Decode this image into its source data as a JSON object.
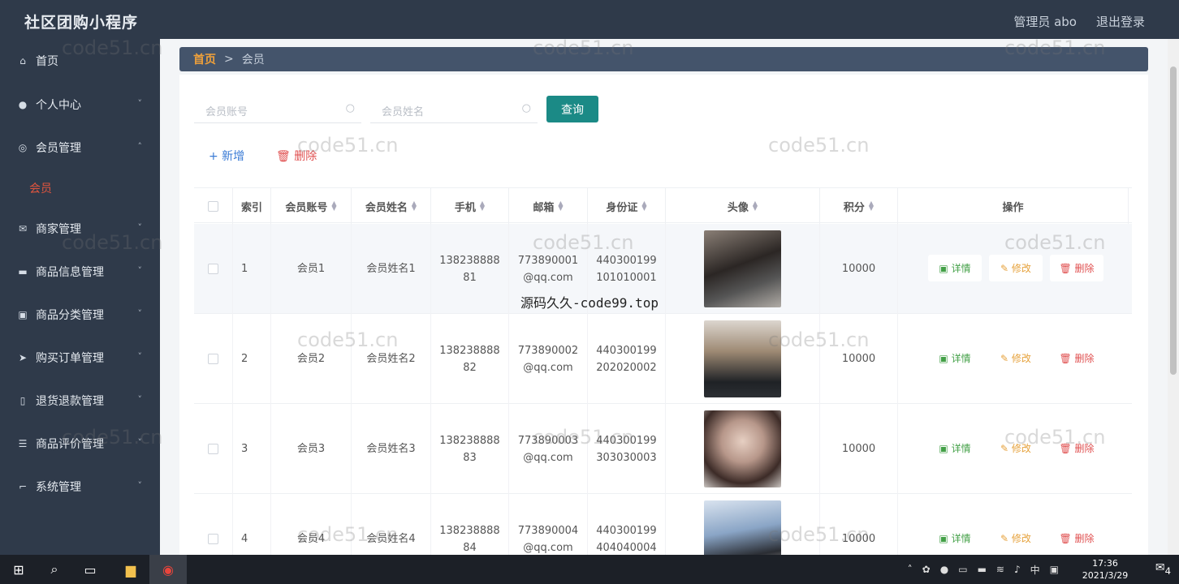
{
  "app": {
    "title": "社区团购小程序",
    "user": "管理员 abo",
    "logout": "退出登录"
  },
  "sidebar": {
    "items": [
      {
        "label": "首页",
        "icon": "home-icon",
        "chevron": ""
      },
      {
        "label": "个人中心",
        "icon": "user-icon",
        "chevron": "˅"
      },
      {
        "label": "会员管理",
        "icon": "member-icon",
        "chevron": "˄"
      },
      {
        "label": "商家管理",
        "icon": "store-icon",
        "chevron": "˅"
      },
      {
        "label": "商品信息管理",
        "icon": "goods-icon",
        "chevron": "˅"
      },
      {
        "label": "商品分类管理",
        "icon": "category-icon",
        "chevron": "˅"
      },
      {
        "label": "购买订单管理",
        "icon": "order-icon",
        "chevron": "˅"
      },
      {
        "label": "退货退款管理",
        "icon": "refund-icon",
        "chevron": "˅"
      },
      {
        "label": "商品评价管理",
        "icon": "review-icon",
        "chevron": "˅"
      },
      {
        "label": "系统管理",
        "icon": "system-icon",
        "chevron": "˅"
      }
    ],
    "sub_active": "会员"
  },
  "breadcrumb": {
    "home": "首页",
    "sep": ">",
    "current": "会员"
  },
  "search": {
    "account_placeholder": "会员账号",
    "name_placeholder": "会员姓名",
    "query_label": "查询"
  },
  "actions": {
    "add_label": "+ 新增",
    "delete_label": "删除"
  },
  "table": {
    "headers": [
      "索引",
      "会员账号",
      "会员姓名",
      "手机",
      "邮箱",
      "身份证",
      "头像",
      "积分",
      "操作"
    ],
    "rows": [
      {
        "index": "1",
        "account": "会员1",
        "name": "会员姓名1",
        "phone_a": "138238888",
        "phone_b": "81",
        "email_a": "773890001",
        "email_b": "@qq.com",
        "id_a": "440300199",
        "id_b": "101010001",
        "points": "10000"
      },
      {
        "index": "2",
        "account": "会员2",
        "name": "会员姓名2",
        "phone_a": "138238888",
        "phone_b": "82",
        "email_a": "773890002",
        "email_b": "@qq.com",
        "id_a": "440300199",
        "id_b": "202020002",
        "points": "10000"
      },
      {
        "index": "3",
        "account": "会员3",
        "name": "会员姓名3",
        "phone_a": "138238888",
        "phone_b": "83",
        "email_a": "773890003",
        "email_b": "@qq.com",
        "id_a": "440300199",
        "id_b": "303030003",
        "points": "10000"
      },
      {
        "index": "4",
        "account": "会员4",
        "name": "会员姓名4",
        "phone_a": "138238888",
        "phone_b": "84",
        "email_a": "773890004",
        "email_b": "@qq.com",
        "id_a": "440300199",
        "id_b": "404040004",
        "points": "10000"
      }
    ],
    "op_labels": {
      "detail": "详情",
      "edit": "修改",
      "remove": "删除"
    }
  },
  "watermarks": {
    "text": "code51.cn",
    "overlay": "源码久久-code99.top"
  },
  "taskbar": {
    "time": "17:36",
    "date": "2021/3/29",
    "ime": "中",
    "notif_count": "4"
  }
}
